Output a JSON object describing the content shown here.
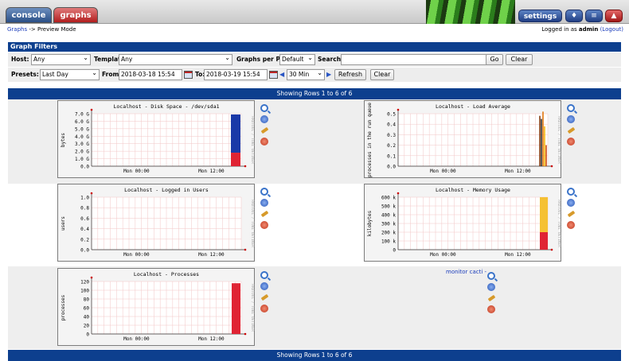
{
  "tabs": [
    {
      "label": "console"
    },
    {
      "label": "graphs"
    }
  ],
  "header": {
    "settings_label": "settings"
  },
  "breadcrumb": {
    "link": "Graphs",
    "separator": " -> ",
    "current": "Preview Mode"
  },
  "login": {
    "prefix": "Logged in as ",
    "user": "admin",
    "logout": "(Logout)"
  },
  "filters": {
    "title": "Graph Filters",
    "host_label": "Host:",
    "host_value": "Any",
    "template_label": "Template:",
    "template_value": "Any",
    "gpp_label": "Graphs per Page:",
    "gpp_value": "Default",
    "search_label": "Search:",
    "search_value": "",
    "go_label": "Go",
    "clear_label": "Clear",
    "presets_label": "Presets:",
    "presets_value": "Last Day",
    "from_label": "From:",
    "from_value": "2018-03-18 15:54",
    "to_label": "To:",
    "to_value": "2018-03-19 15:54",
    "timespan_value": "30 Min",
    "refresh_label": "Refresh",
    "clear2_label": "Clear"
  },
  "rows_text": "Showing Rows 1 to 6 of 6",
  "monitor_link": "monitor cacti -",
  "colors": {
    "header_blue": "#0d3f8e",
    "band_grey": "#eeeeee",
    "console_tab": "#2a4f86",
    "graphs_tab": "#b21e1e"
  },
  "graphs": [
    {
      "title": "Localhost - Disk Space - /dev/sda1",
      "ylabel": "bytes",
      "yticks": [
        "7.0 G",
        "6.0 G",
        "5.0 G",
        "4.0 G",
        "3.0 G",
        "2.0 G",
        "1.0 G",
        "0.0"
      ],
      "xticks": [
        "Mon 00:00",
        "Mon 12:00"
      ],
      "chart_data": {
        "type": "area",
        "series": [
          {
            "values_top": 7.0,
            "values_bottom": 1.8
          }
        ],
        "ylim": [
          0,
          7.0
        ]
      }
    },
    {
      "title": "Localhost - Load Average",
      "ylabel": "processes in the run queue",
      "yticks": [
        "0.5",
        "0.4",
        "0.3",
        "0.2",
        "0.1",
        "0.0"
      ],
      "xticks": [
        "Mon 00:00",
        "Mon 12:00"
      ],
      "chart_data": {
        "type": "line",
        "ylim": [
          0,
          0.5
        ]
      }
    },
    {
      "title": "Localhost - Logged in Users",
      "ylabel": "users",
      "yticks": [
        "1.0",
        "0.8",
        "0.6",
        "0.4",
        "0.2",
        "0.0"
      ],
      "xticks": [
        "Mon 00:00",
        "Mon 12:00"
      ],
      "chart_data": {
        "type": "line",
        "ylim": [
          0,
          1.0
        ]
      }
    },
    {
      "title": "Localhost - Memory Usage",
      "ylabel": "kilobytes",
      "yticks": [
        "600 k",
        "500 k",
        "400 k",
        "300 k",
        "200 k",
        "100 k",
        "0"
      ],
      "xticks": [
        "Mon 00:00",
        "Mon 12:00"
      ],
      "chart_data": {
        "type": "area",
        "ylim": [
          0,
          600
        ]
      }
    },
    {
      "title": "Localhost - Processes",
      "ylabel": "processes",
      "yticks": [
        "120",
        "100",
        "80",
        "60",
        "40",
        "20",
        "0"
      ],
      "xticks": [
        "Mon 00:00",
        "Mon 12:00"
      ],
      "chart_data": {
        "type": "area",
        "ylim": [
          0,
          120
        ]
      }
    }
  ],
  "side_label": "RRDTOOL / TOBI OETIKER"
}
